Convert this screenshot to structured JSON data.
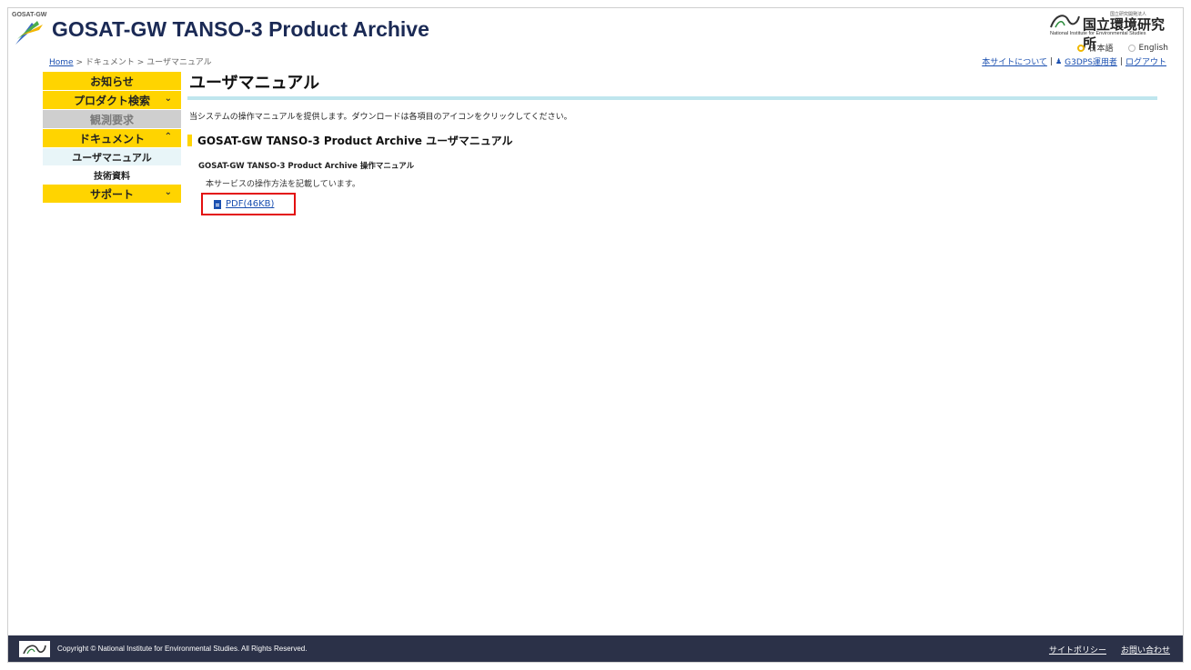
{
  "header": {
    "logo_small_text": "GOSAT-GW",
    "site_title": "GOSAT-GW TANSO-3 Product Archive",
    "nies_kanji": "国立環境研究所",
    "nies_small": "国立研究開発法人",
    "nies_english": "National Institute for Environmental Studies",
    "lang_ja": "日本語",
    "lang_en": "English"
  },
  "breadcrumb": {
    "home": "Home",
    "sep1": " > ",
    "level1": "ドキュメント",
    "sep2": " > ",
    "level2": "ユーザマニュアル"
  },
  "toplinks": {
    "about": "本サイトについて",
    "sep1": "|",
    "user": "G3DPS運用者",
    "sep2": "|",
    "logout": "ログアウト"
  },
  "sidebar": {
    "items": [
      {
        "label": "お知らせ"
      },
      {
        "label": "プロダクト検索",
        "chevron": "⌄"
      },
      {
        "label": "観測要求"
      },
      {
        "label": "ドキュメント",
        "chevron": "⌃"
      },
      {
        "label": "ユーザマニュアル"
      },
      {
        "label": "技術資料"
      },
      {
        "label": "サポート",
        "chevron": "⌄"
      }
    ]
  },
  "main": {
    "title": "ユーザマニュアル",
    "intro": "当システムの操作マニュアルを提供します。ダウンロードは各項目のアイコンをクリックしてください。",
    "section_title": "GOSAT-GW TANSO-3 Product Archive ユーザマニュアル",
    "doc_name": "GOSAT-GW TANSO-3 Product Archive 操作マニュアル",
    "doc_desc": "本サービスの操作方法を記載しています。",
    "pdf_link": "PDF(46KB)"
  },
  "footer": {
    "copyright": "Copyright © National Institute for Environmental Studies. All Rights Reserved.",
    "policy": "サイトポリシー",
    "contact": "お問い合わせ"
  },
  "colors": {
    "accent_yellow": "#ffd400",
    "title_bar": "#bfe6ee",
    "footer_bg": "#2b3148",
    "link_blue": "#1a4fb0",
    "highlight_red": "#e30f0f"
  }
}
